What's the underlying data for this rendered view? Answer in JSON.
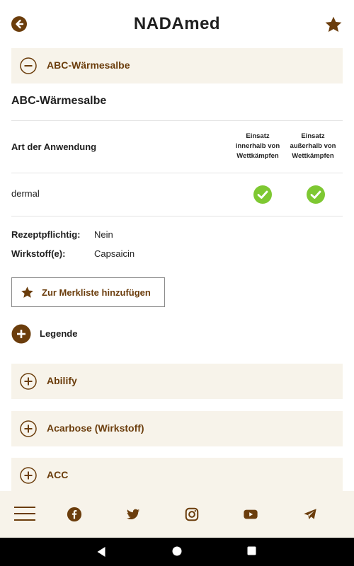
{
  "header": {
    "title": "NADAmed"
  },
  "expanded_item": {
    "label": "ABC-Wärmesalbe"
  },
  "detail": {
    "name": "ABC-Wärmesalbe",
    "col_application": "Art der Anwendung",
    "col_in_comp": "Einsatz innerhalb von Wettkämpfen",
    "col_out_comp": "Einsatz außerhalb von Wettkämpfen",
    "rows": [
      {
        "application": "dermal",
        "in_comp_allowed": true,
        "out_comp_allowed": true
      }
    ],
    "rx_label": "Rezeptpflichtig:",
    "rx_value": "Nein",
    "agent_label": "Wirkstoff(e):",
    "agent_value": "Capsaicin",
    "watchlist_button": "Zur Merkliste hinzufügen"
  },
  "legend": {
    "label": "Legende"
  },
  "list_items": [
    {
      "label": "Abilify"
    },
    {
      "label": "Acarbose (Wirkstoff)"
    },
    {
      "label": "ACC"
    }
  ],
  "colors": {
    "brand_brown": "#6b3d0c",
    "panel_bg": "#f7f3ea",
    "check_green": "#7ec832"
  },
  "icons": {
    "back": "back-arrow-icon",
    "favorite": "star-icon",
    "collapse": "minus-circle-icon",
    "expand": "plus-circle-icon",
    "allowed": "check-circle-icon",
    "social": [
      "facebook-icon",
      "twitter-icon",
      "instagram-icon",
      "youtube-icon",
      "telegram-icon"
    ]
  }
}
